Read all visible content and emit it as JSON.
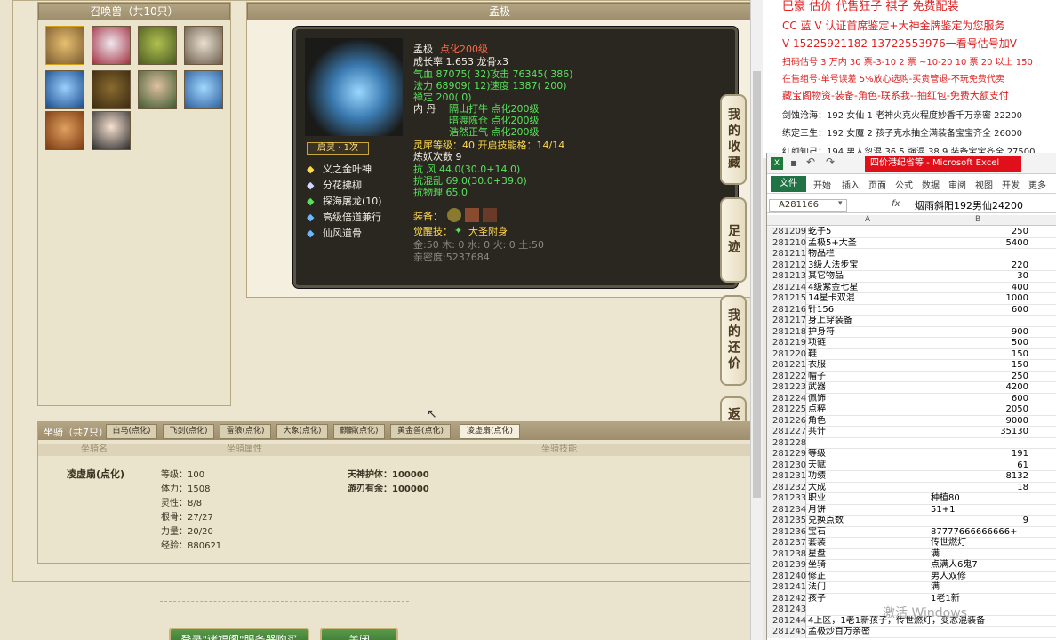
{
  "summon_panel": {
    "title": "召唤兽（共10只）"
  },
  "detail": {
    "header": "孟极",
    "name": "孟极",
    "name_tag": "点化200级",
    "growth": "成长率 1.653 龙骨x3",
    "stats": [
      {
        "label": "气血 87075( 32)",
        "v2": "攻击 76345( 386)"
      },
      {
        "label": "法力 68909( 12)",
        "v2": "速度 1387( 200)"
      }
    ],
    "chan": "禅定 200( 0)",
    "neidan": [
      {
        "k": "内   丹",
        "v": "隔山打牛 点化200级"
      },
      {
        "k": "",
        "v": "暗渡陈仓 点化200级"
      },
      {
        "k": "",
        "v": "浩然正气 点化200级"
      }
    ],
    "lingxi": "灵犀等级：40 开启技能格：14/14",
    "lianyao": "炼妖次数 9",
    "resist": [
      "抗   风 44.0(30.0+14.0)",
      "抗混乱 69.0(30.0+39.0)",
      "抗物理 65.0"
    ],
    "qiling": "启灵 · 1次",
    "skills": [
      "义之金叶神",
      "分花拂柳",
      "探海屠龙(10)",
      "高级倍道兼行",
      "仙风道骨"
    ],
    "equip_label": "装备：",
    "awaken_label": "觉醒技：",
    "awaken": "大圣附身",
    "elements": "金:50 木: 0 水: 0 火: 0 土:50",
    "intimacy": "亲密度:5237684"
  },
  "side_buttons": [
    "我的收藏",
    "足迹",
    "我的还价",
    "返回顶部"
  ],
  "mount": {
    "title": "坐骑（共7只）",
    "tabs": [
      "白马(点化)",
      "飞剑(点化)",
      "雷狼(点化)",
      "大象(点化)",
      "麒麟(点化)",
      "黄金兽(点化)",
      "凌虚扇(点化)"
    ],
    "col_name": "坐骑名",
    "col_attr": "坐骑属性",
    "col_skill": "坐骑技能",
    "name": "凌虚扇(点化)",
    "attrs": [
      "等级：100",
      "体力：1508",
      "灵性：8/8",
      "根骨：27/27",
      "力量：20/20",
      "经验：880621"
    ],
    "skills": [
      "天神护体：100000",
      "游刃有余：100000"
    ]
  },
  "bottom_buttons": [
    "登录\"诸福阁\"服务器购买",
    "关闭"
  ],
  "ad": {
    "lines": [
      "巴豪 估价 代售狂子 祺子 免费配装",
      "CC 蓝 V 认证首席鉴定+大神金牌鉴定为您服务",
      "V 15225921182    13722553976一看号估号加V",
      "扫码估号 3 万内 30 票-3-10 2 票 ~10-20 10 票 20 以上 150",
      "在售组号-单号误差 5%放心选购-买贵管退-不玩免费代卖",
      "藏宝阁物资-装备-角色-联系我--抽红包-免费大额支付",
      "剑蚀沧海：192 女仙 1 老神火克火程度妙香千万亲密 22200",
      "练定三生：192 女魔 2 孩子克水抽全满装备宝宝齐全 26000",
      "红颜知己：194 男人忽混 36.5 强混 38.9 装备宝宝齐全 27500"
    ]
  },
  "excel": {
    "title": "四价港纪省等 - Microsoft Excel",
    "tabs": [
      "文件",
      "开始",
      "插入",
      "页面",
      "公式",
      "数据",
      "审阅",
      "视图",
      "开发",
      "更多"
    ],
    "namebox": "A281166",
    "fx": "fx",
    "formula": "烟雨斜阳192男仙24200",
    "col_a": "A",
    "col_b": "B",
    "rows": [
      [
        "281209",
        "虼子5",
        "250"
      ],
      [
        "281210",
        "孟极5+大圣",
        "5400"
      ],
      [
        "281211",
        "物品栏",
        ""
      ],
      [
        "281212",
        "3级人法步宝",
        "220"
      ],
      [
        "281213",
        "其它物品",
        "30"
      ],
      [
        "281214",
        "4级紫金七星",
        "400"
      ],
      [
        "281215",
        "14星卡双混",
        "1000"
      ],
      [
        "281216",
        "针156",
        "600"
      ],
      [
        "281217",
        "身上穿装备",
        ""
      ],
      [
        "281218",
        "护身符",
        "900"
      ],
      [
        "281219",
        "项链",
        "500"
      ],
      [
        "281220",
        "鞋",
        "150"
      ],
      [
        "281221",
        "衣服",
        "150"
      ],
      [
        "281222",
        "帽子",
        "250"
      ],
      [
        "281223",
        "武器",
        "4200"
      ],
      [
        "281224",
        "佩饰",
        "600"
      ],
      [
        "281225",
        "点粹",
        "2050"
      ],
      [
        "281226",
        "角色",
        "9000"
      ],
      [
        "281227",
        "共计",
        "35130"
      ],
      [
        "281228",
        "",
        ""
      ],
      [
        "281229",
        "等级",
        "191"
      ],
      [
        "281230",
        "天赋",
        "61"
      ],
      [
        "281231",
        "功绩",
        "8132"
      ],
      [
        "281232",
        "大成",
        "18"
      ],
      [
        "281233",
        "职业",
        "种植80"
      ],
      [
        "281234",
        "月饼",
        "51+1"
      ],
      [
        "281235",
        "兑换点数",
        "9"
      ],
      [
        "281236",
        "宝石",
        "87777666666666+"
      ],
      [
        "281237",
        "套装",
        "传世燃灯"
      ],
      [
        "281238",
        "星盘",
        "满"
      ],
      [
        "281239",
        "坐骑",
        "点满人6鬼7"
      ],
      [
        "281240",
        "修正",
        "男人双修"
      ],
      [
        "281241",
        "法门",
        "满"
      ],
      [
        "281242",
        "孩子",
        "1老1新"
      ],
      [
        "281243",
        "",
        ""
      ],
      [
        "281244",
        "4上区，1老1新孩子，传世燃灯，变态混装备",
        ""
      ],
      [
        "281245",
        "孟极炒百万亲密",
        ""
      ]
    ],
    "watermark": "激活 Windows"
  }
}
